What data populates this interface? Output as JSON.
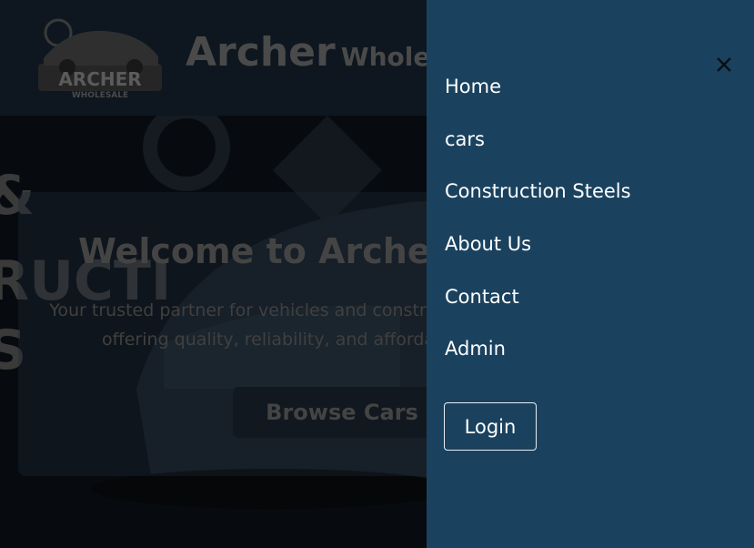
{
  "brand": {
    "title": "Archer",
    "subtitle": "Wholesale",
    "logo_text": "ARCHER",
    "logo_sub": "WHOLESALE"
  },
  "hero": {
    "side_words": [
      "&",
      "RUCTI",
      "S"
    ],
    "welcome": "Welcome to Archer Wholesale",
    "tagline": "Your trusted partner for vehicles and construction steel, offering quality, reliability, and affordability.",
    "browse_label": "Browse Cars"
  },
  "drawer": {
    "close_icon": "close-icon",
    "items": [
      {
        "label": "Home"
      },
      {
        "label": "cars"
      },
      {
        "label": "Construction Steels"
      },
      {
        "label": "About Us"
      },
      {
        "label": "Contact"
      },
      {
        "label": "Admin"
      }
    ],
    "login_label": "Login"
  },
  "colors": {
    "drawer_bg": "#1a425f",
    "text": "#ffffff",
    "dim_bg": "#0b1117"
  }
}
